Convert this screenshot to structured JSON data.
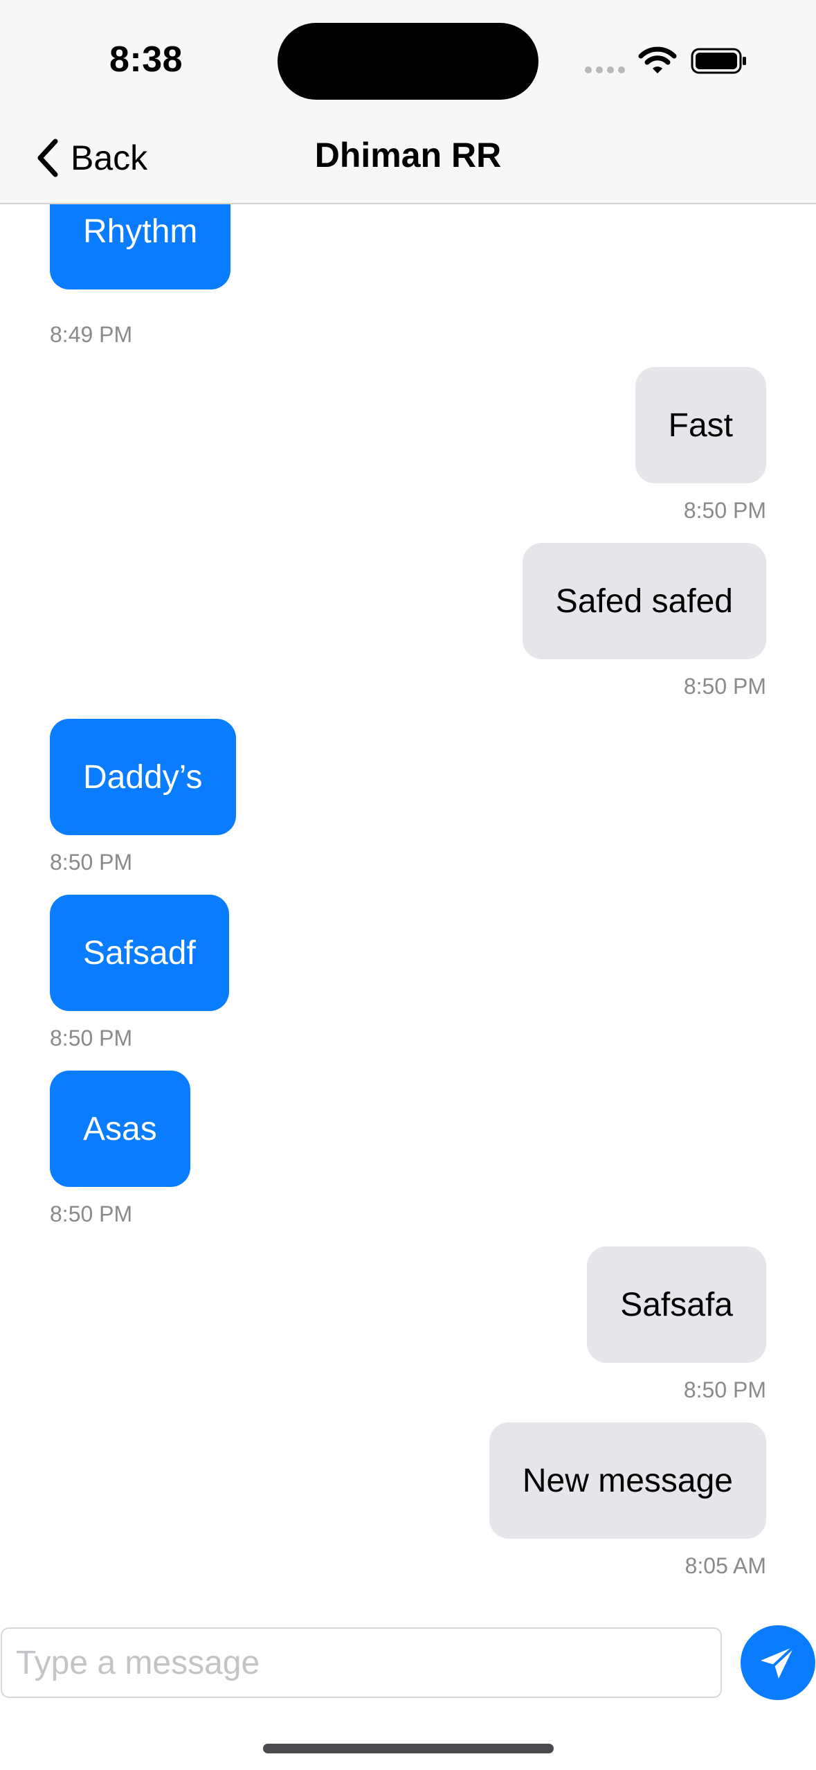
{
  "status_bar": {
    "time": "8:38"
  },
  "nav": {
    "back_label": "Back",
    "title": "Dhiman RR"
  },
  "messages": [
    {
      "side": "left",
      "text": "Rhythm",
      "time": "8:49 PM"
    },
    {
      "side": "right",
      "text": "Fast",
      "time": "8:50 PM"
    },
    {
      "side": "right",
      "text": "Safed safed",
      "time": "8:50 PM"
    },
    {
      "side": "left",
      "text": "Daddy’s",
      "time": "8:50 PM"
    },
    {
      "side": "left",
      "text": "Safsadf",
      "time": "8:50 PM"
    },
    {
      "side": "left",
      "text": "Asas",
      "time": "8:50 PM"
    },
    {
      "side": "right",
      "text": "Safsafa",
      "time": "8:50 PM"
    },
    {
      "side": "right",
      "text": "New message",
      "time": "8:05 AM"
    }
  ],
  "composer": {
    "value": "",
    "placeholder": "Type a message",
    "send_icon": "paper-plane-icon"
  },
  "colors": {
    "sent_bubble": "#e5e5ea",
    "received_bubble": "#0a7cff",
    "accent": "#0a7cff"
  }
}
